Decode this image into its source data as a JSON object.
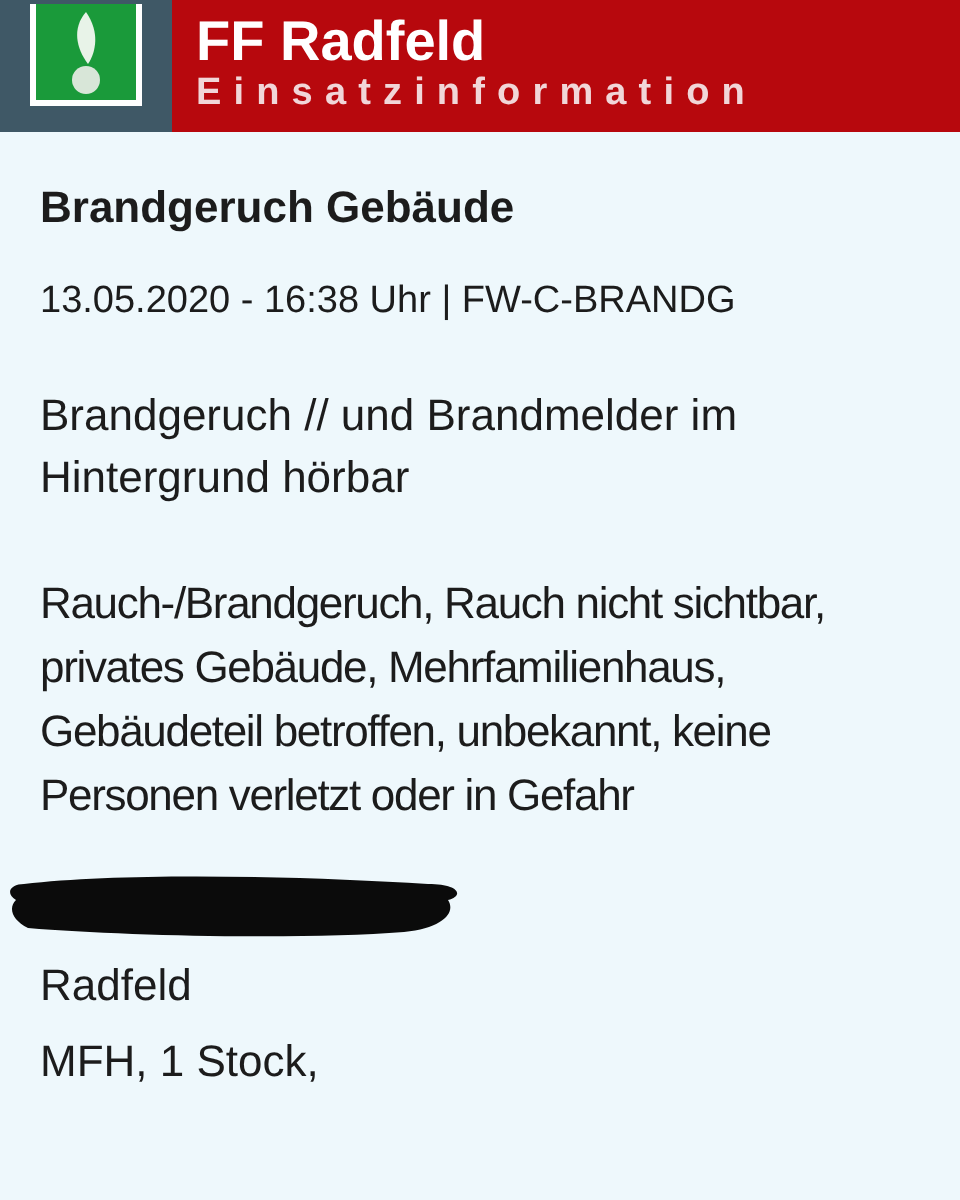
{
  "header": {
    "title": "FF Radfeld",
    "subtitle": "Einsatzinformation"
  },
  "incident": {
    "title": "Brandgeruch Gebäude",
    "meta": "13.05.2020 - 16:38 Uhr | FW-C-BRANDG",
    "summary": "Brandgeruch // und Brandmelder im Hintergrund hörbar",
    "details": "Rauch-/Brandgeruch, Rauch nicht sichtbar, privates Gebäude, Mehrfamilienhaus, Gebäudeteil betroffen, unbekannt, keine Personen verletzt oder in Gefahr",
    "redacted": true,
    "location": [
      "Radfeld",
      "MFH, 1 Stock,"
    ]
  }
}
